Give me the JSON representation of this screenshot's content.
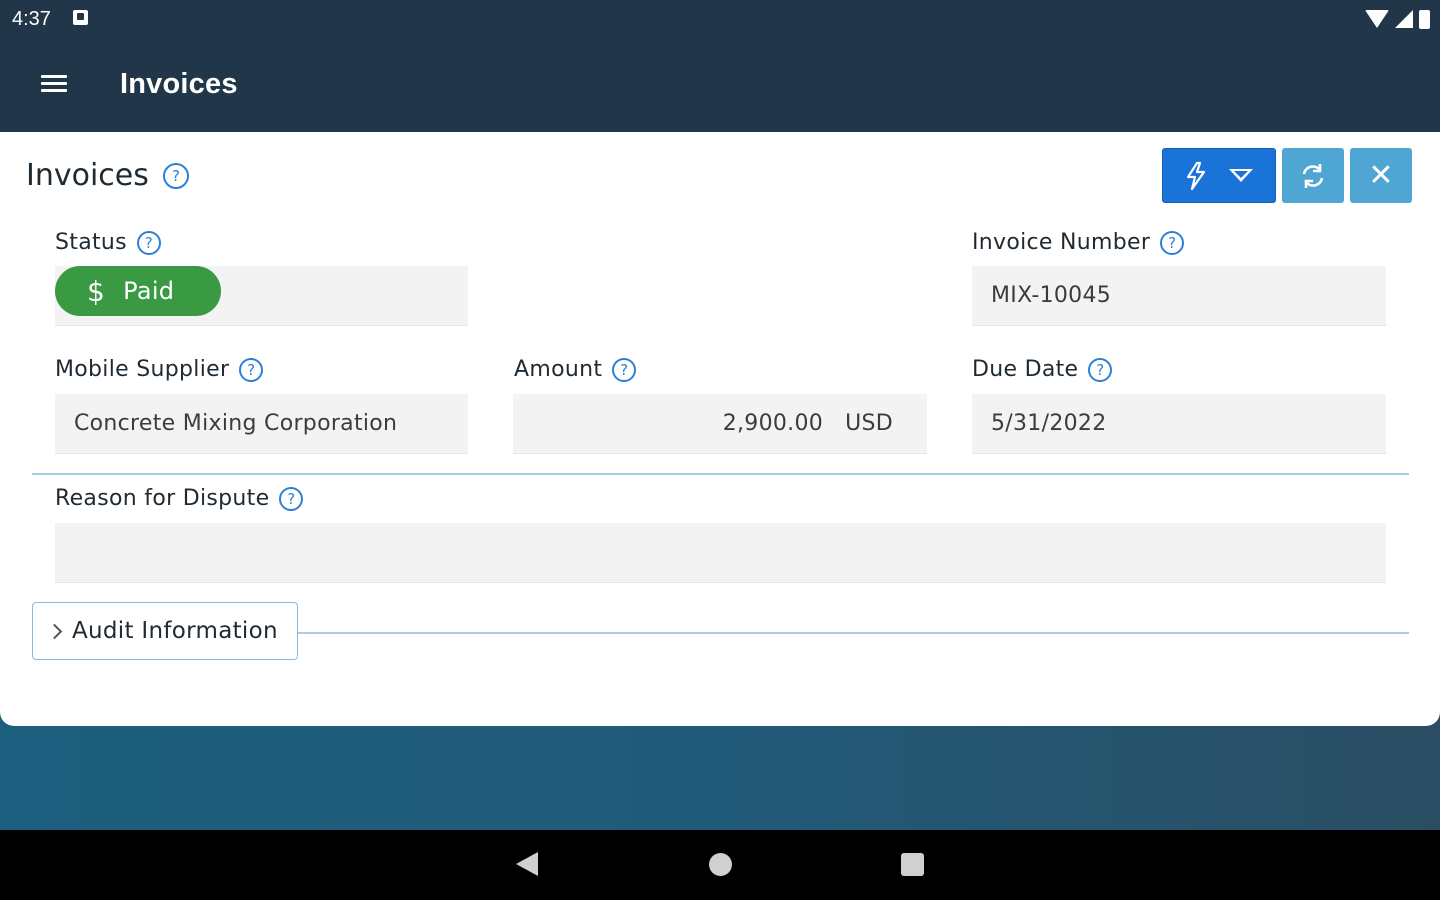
{
  "status_bar": {
    "time": "4:37",
    "icons": [
      "notification-icon",
      "wifi-icon",
      "signal-icon",
      "battery-icon"
    ]
  },
  "app_bar": {
    "title": "Invoices",
    "menu_icon": "hamburger-menu-icon"
  },
  "page": {
    "title": "Invoices",
    "help": "?"
  },
  "toolbar": {
    "actions_icon": "lightning-icon",
    "dropdown_icon": "caret-down-icon",
    "refresh_icon": "refresh-icon",
    "close_icon": "close-icon",
    "close_glyph": "✕",
    "colors": {
      "primary": "#1a73d9",
      "secondary": "#4fa6d2"
    }
  },
  "fields": {
    "status": {
      "label": "Status",
      "value": "Paid",
      "glyph": "$",
      "color": "#3a9a43"
    },
    "invoice_number": {
      "label": "Invoice Number",
      "value": "MIX-10045"
    },
    "mobile_supplier": {
      "label": "Mobile Supplier",
      "value": "Concrete Mixing Corporation"
    },
    "amount": {
      "label": "Amount",
      "value": "2,900.00",
      "currency": "USD"
    },
    "due_date": {
      "label": "Due Date",
      "value": "5/31/2022"
    },
    "reason_for_dispute": {
      "label": "Reason for Dispute",
      "value": ""
    }
  },
  "sections": {
    "audit_information": {
      "label": "Audit Information"
    }
  },
  "help_glyph": "?"
}
